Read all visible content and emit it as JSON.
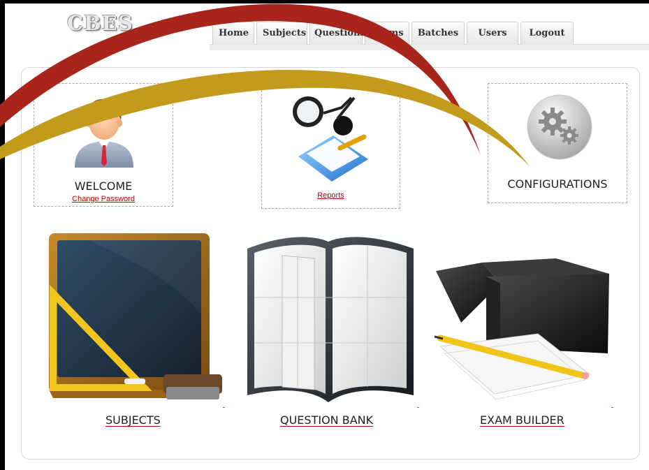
{
  "logo": {
    "text": "CBES"
  },
  "nav": {
    "tabs": [
      {
        "label": "Home"
      },
      {
        "label": "Subjects"
      },
      {
        "label": "Questions"
      },
      {
        "label": "Exams"
      },
      {
        "label": "Batches"
      },
      {
        "label": "Users"
      },
      {
        "label": "Logout"
      }
    ]
  },
  "welcome": {
    "title": "WELCOME",
    "link": "Change Password",
    "icon": "user-avatar-icon"
  },
  "reports": {
    "link": "Reports",
    "icon": "reports-magnifier-icon"
  },
  "configurations": {
    "title": "CONFIGURATIONS",
    "icon": "gears-icon"
  },
  "modules": [
    {
      "label": "SUBJECTS",
      "icon": "chalkboard-icon"
    },
    {
      "label": "QUESTION BANK",
      "icon": "book-icon"
    },
    {
      "label": "EXAM BUILDER",
      "icon": "box-pencil-icon"
    }
  ],
  "colors": {
    "link": "#c00000",
    "swoosh_red": "#a8251b",
    "swoosh_gold": "#c29a1c"
  }
}
